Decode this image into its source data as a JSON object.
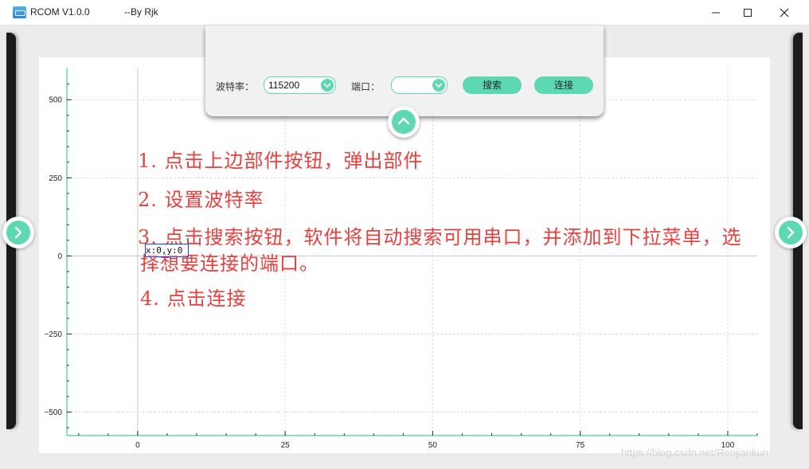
{
  "window": {
    "title": "RCOM V1.0.0",
    "author": "--By Rjk"
  },
  "panel": {
    "baud_label": "波特率：",
    "baud_value": "115200",
    "port_label": "端口：",
    "port_value": "",
    "search_label": "搜索",
    "connect_label": "连接"
  },
  "instructions": {
    "step1": "1. 点击上边部件按钮，弹出部件",
    "step2": "2. 设置波特率",
    "step3_line1": "3. 点击搜索按钮，软件将自动搜索可用串口，并添加到下拉菜单，选",
    "step3_line2": "择想要连接的端口。",
    "step4": "4. 点击连接"
  },
  "coord_readout": "x:0,y:0",
  "watermark": "https://blog.csdn.net/Renjiankun",
  "colors": {
    "accent": "#5ed7b3",
    "instruction_text": "#e8403e",
    "side_bar": "#1c1c1c"
  },
  "icons": {
    "app": "app-icon",
    "minimize": "minimize-icon",
    "maximize": "maximize-icon",
    "close": "close-icon",
    "combo_arrow": "chevron-down-icon",
    "panel_toggle": "chevron-up-icon",
    "side_toggle": "chevron-right-icon"
  },
  "chart_data": {
    "type": "line",
    "title": "",
    "xlabel": "",
    "ylabel": "",
    "xlim": [
      -12,
      105
    ],
    "ylim": [
      -575,
      600
    ],
    "x_ticks": [
      0,
      25,
      50,
      75,
      100
    ],
    "y_ticks": [
      500,
      250,
      0,
      -250,
      -500
    ],
    "x_tick_labels": [
      "0",
      "25",
      "50",
      "75",
      "100"
    ],
    "y_tick_labels": [
      "500",
      "250",
      "0",
      "−250",
      "−500"
    ],
    "grid": true,
    "series": []
  }
}
